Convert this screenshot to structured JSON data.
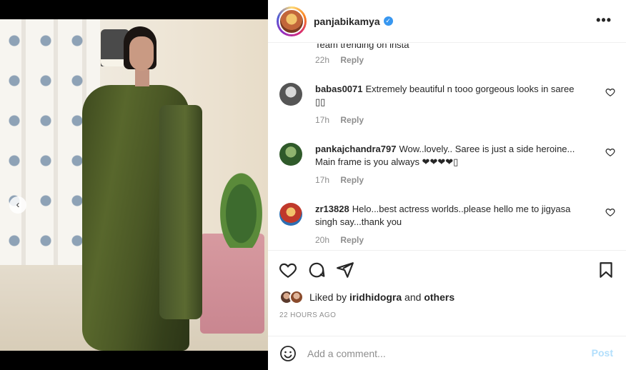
{
  "post": {
    "username": "panjabikamya",
    "verified_icon": "verified-badge-icon",
    "more_label": "•••"
  },
  "carousel": {
    "prev_glyph": "‹",
    "dots": 4,
    "active_dot": 3
  },
  "comments": {
    "partial": {
      "text": "Team trending on insta",
      "time": "22h",
      "reply_label": "Reply"
    },
    "items": [
      {
        "username": "babas0071",
        "text": "Extremely beautiful n tooo gorgeous looks in saree ▯▯",
        "time": "17h",
        "reply_label": "Reply",
        "avatar_color": "#6d6d6d"
      },
      {
        "username": "pankajchandra797",
        "text": "Wow..lovely.. Saree is just a side heroine... Main frame is you always ❤❤❤❤▯",
        "time": "17h",
        "reply_label": "Reply",
        "avatar_color": "#4f7a3b"
      },
      {
        "username": "zr13828",
        "text": "Helo...best actress worlds..please hello me to jigyasa singh say...thank you",
        "time": "20h",
        "reply_label": "Reply",
        "avatar_color": "#c0392b"
      }
    ]
  },
  "likes": {
    "prefix": "Liked by ",
    "user": "iridhidogra",
    "middle": " and ",
    "suffix": "others"
  },
  "timestamp": "22 HOURS AGO",
  "comment_box": {
    "placeholder": "Add a comment...",
    "post_label": "Post"
  },
  "colors": {
    "accent": "#3897f0",
    "post_disabled": "#b2dffc",
    "muted": "#8e8e8e",
    "text": "#262626"
  }
}
